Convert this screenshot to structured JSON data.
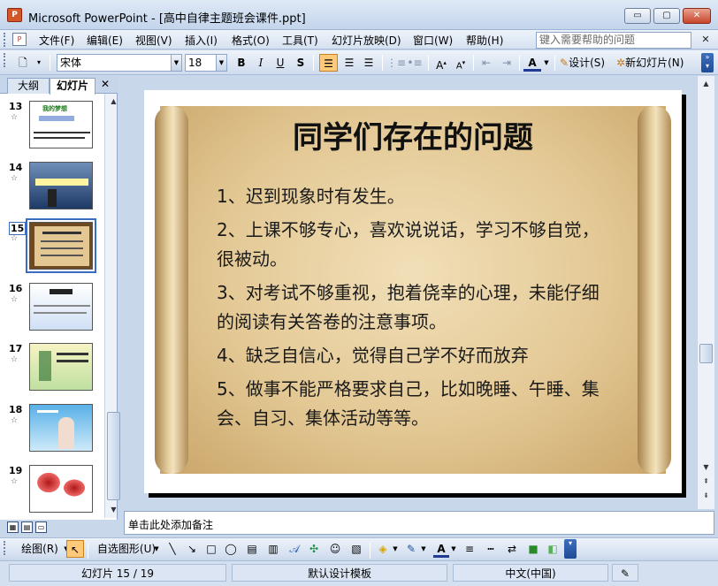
{
  "window": {
    "title": "Microsoft PowerPoint - [高中自律主题班会课件.ppt]",
    "app_icon": "ppt-app-icon",
    "minimize_glyph": "▭",
    "maximize_glyph": "▢",
    "close_glyph": "✕"
  },
  "menu": {
    "items": [
      "文件(F)",
      "编辑(E)",
      "视图(V)",
      "插入(I)",
      "格式(O)",
      "工具(T)",
      "幻灯片放映(D)",
      "窗口(W)",
      "帮助(H)"
    ],
    "help_placeholder": "键入需要帮助的问题",
    "close_glyph": "✕"
  },
  "format_toolbar": {
    "font_name": "宋体",
    "font_size": "18",
    "bold": "B",
    "italic": "I",
    "underline": "U",
    "shadow": "S",
    "design_label": "设计(S)",
    "new_slide_label": "新幻灯片(N)"
  },
  "slide_panel": {
    "tab_outline": "大纲",
    "tab_slides": "幻灯片",
    "close_glyph": "✕",
    "star_glyph": "☆",
    "thumbnails": [
      {
        "num": "13",
        "title": "我的梦想"
      },
      {
        "num": "14",
        "title": ""
      },
      {
        "num": "15",
        "title": ""
      },
      {
        "num": "16",
        "title": ""
      },
      {
        "num": "17",
        "title": ""
      },
      {
        "num": "18",
        "title": ""
      },
      {
        "num": "19",
        "title": ""
      }
    ],
    "selected_index": 2
  },
  "slide": {
    "title": "同学们存在的问题",
    "points": [
      "1、迟到现象时有发生。",
      "2、上课不够专心，喜欢说说话，学习不够自觉，很被动。",
      "3、对考试不够重视，抱着侥幸的心理，未能仔细的阅读有关答卷的注意事项。",
      "4、缺乏自信心，觉得自己学不好而放弃",
      "5、做事不能严格要求自己，比如晚睡、午睡、集会、自习、集体活动等等。"
    ]
  },
  "notes": {
    "placeholder": "单击此处添加备注"
  },
  "draw_toolbar": {
    "draw_label": "绘图(R)",
    "autoshape_label": "自选图形(U)"
  },
  "status": {
    "slide_info": "幻灯片 15 / 19",
    "template": "默认设计模板",
    "language": "中文(中国)"
  },
  "colors": {
    "accent": "#3a6dc0",
    "selected_button": "#ffc97a",
    "scroll_parchment": "#e3c894"
  }
}
